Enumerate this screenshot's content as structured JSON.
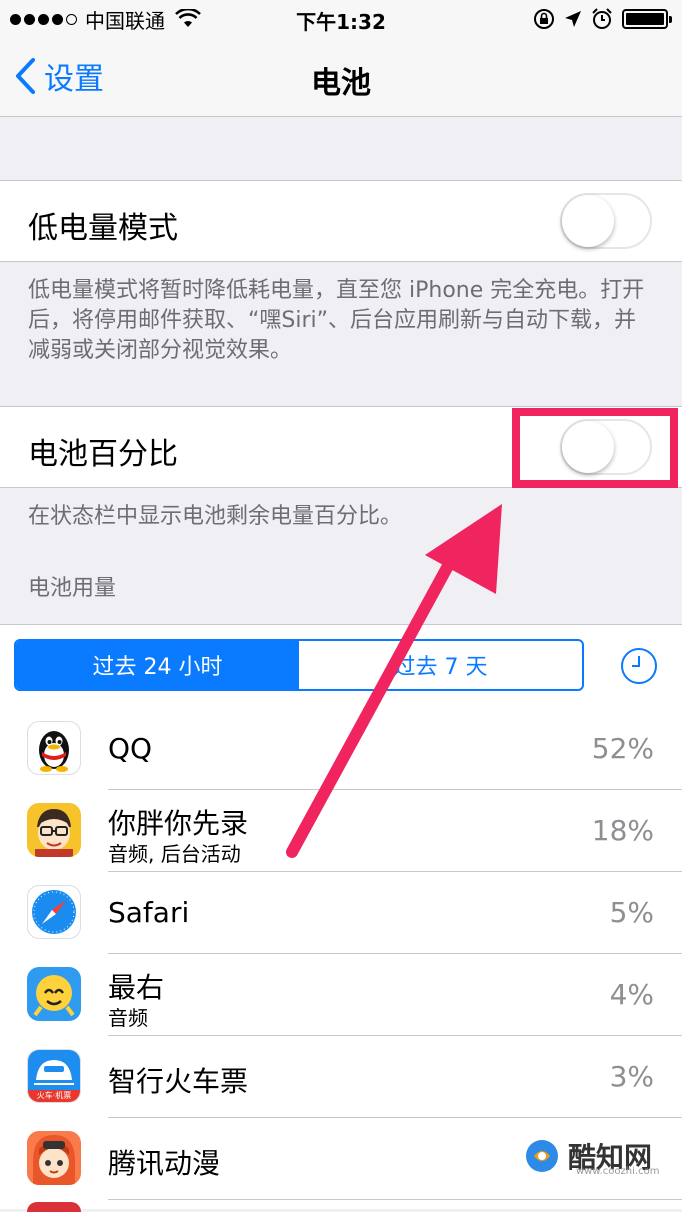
{
  "status_bar": {
    "carrier": "中国联通",
    "time": "下午1:32"
  },
  "nav": {
    "back_label": "设置",
    "title": "电池"
  },
  "low_power": {
    "label": "低电量模式",
    "enabled": false,
    "footnote": "低电量模式将暂时降低耗电量，直至您 iPhone 完全充电。打开后，将停用邮件获取、“嘿Siri”、后台应用刷新与自动下载，并减弱或关闭部分视觉效果。"
  },
  "battery_percentage": {
    "label": "电池百分比",
    "enabled": false,
    "footnote": "在状态栏中显示电池剩余电量百分比。"
  },
  "usage": {
    "header": "电池用量",
    "segments": [
      "过去 24 小时",
      "过去 7 天"
    ],
    "selected_segment": 0
  },
  "apps": [
    {
      "name": "QQ",
      "sub": "",
      "percent": "52%",
      "icon": "qq-penguin-icon"
    },
    {
      "name": "你胖你先录",
      "sub": "音频, 后台活动",
      "percent": "18%",
      "icon": "cartoon-face-icon"
    },
    {
      "name": "Safari",
      "sub": "",
      "percent": "5%",
      "icon": "compass-icon"
    },
    {
      "name": "最右",
      "sub": "音频",
      "percent": "4%",
      "icon": "zuiyou-icon"
    },
    {
      "name": "智行火车票",
      "sub": "",
      "percent": "3%",
      "icon": "train-icon"
    },
    {
      "name": "腾讯动漫",
      "sub": "",
      "percent": "",
      "icon": "anime-girl-icon"
    }
  ],
  "train_icon_text": "火车·机票",
  "watermark": {
    "text": "酷知网",
    "url": "www.coozhi.com"
  },
  "colors": {
    "ios_blue": "#0a7aff",
    "highlight_pink": "#f0245e",
    "group_bg": "#efeff4"
  }
}
